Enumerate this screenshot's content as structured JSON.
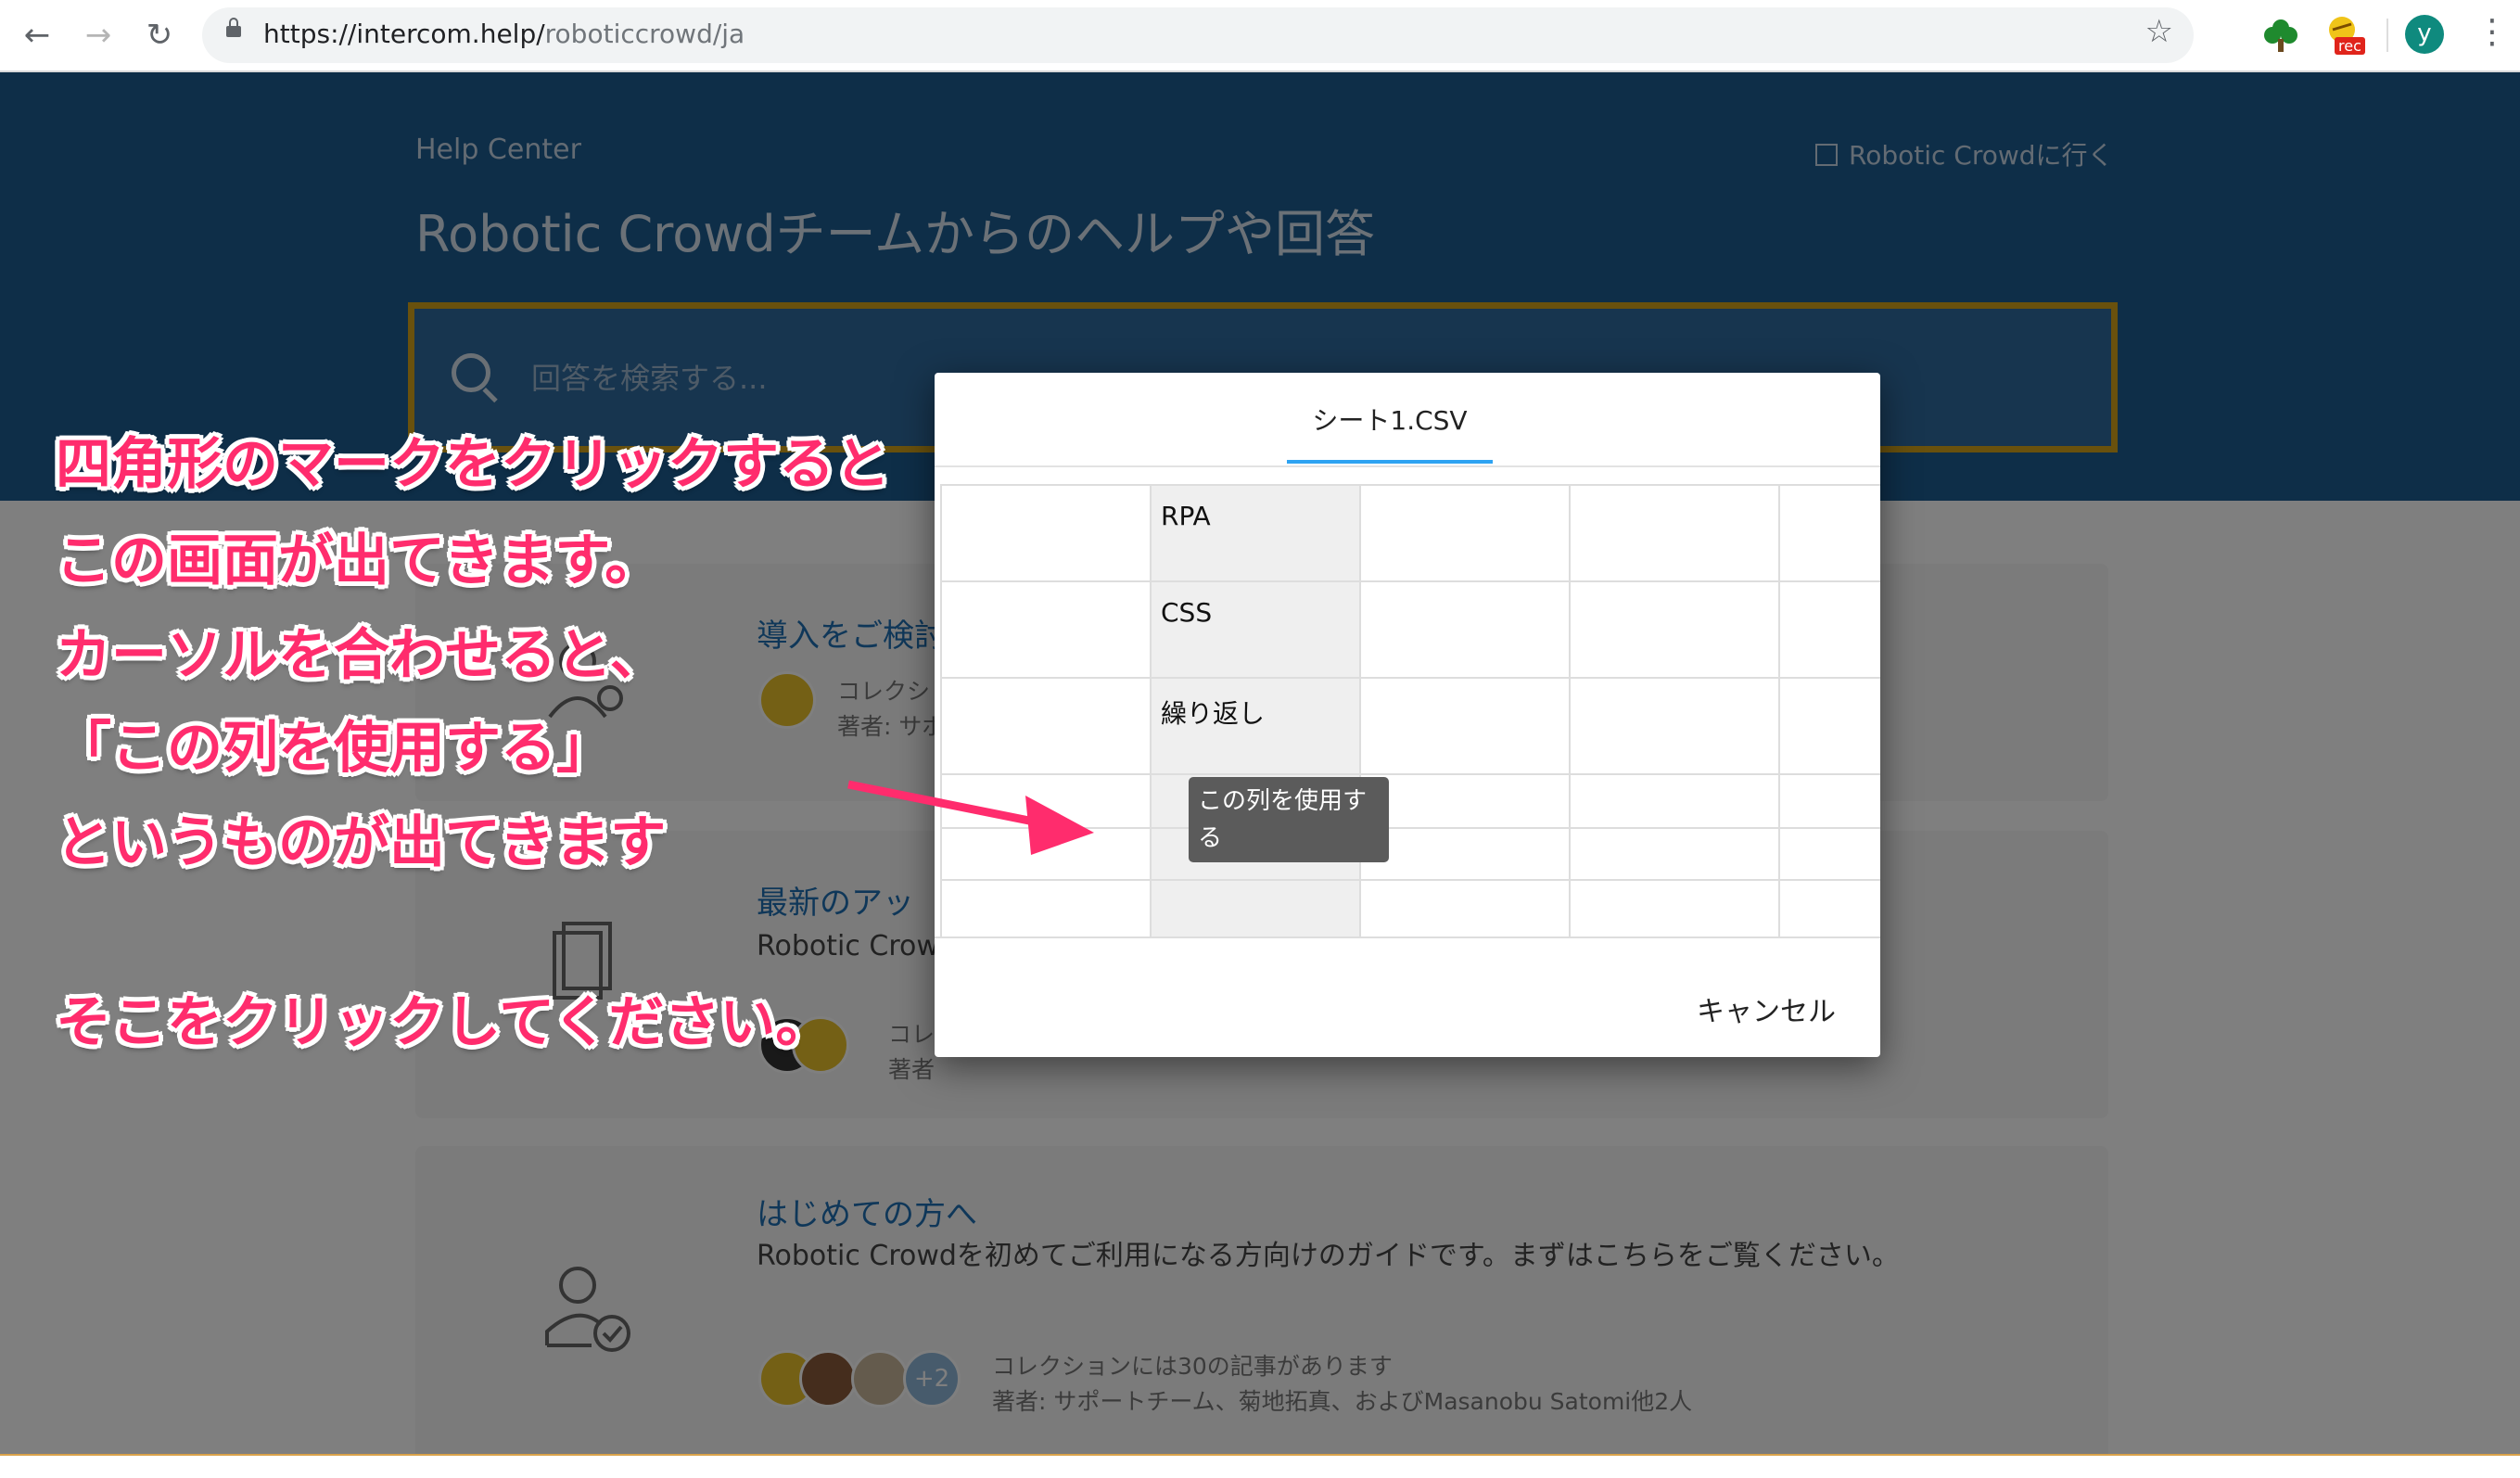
{
  "browser": {
    "url_host": "https://intercom.help/",
    "url_path": "roboticcrowd/ja",
    "profile_initial": "y",
    "rec_badge": "rec"
  },
  "help": {
    "help_center_label": "Help Center",
    "goto_link": "Robotic Crowdに行く",
    "title": "Robotic Crowdチームからのヘルプや回答",
    "search_placeholder": "回答を検索する..."
  },
  "cards": [
    {
      "title": "導入をご検討",
      "meta1": "コレクシ",
      "meta2": "著者: サポ"
    },
    {
      "title": "最新のアッ",
      "desc": "Robotic Crow",
      "meta1": "コレ",
      "meta2": "著者"
    },
    {
      "title": "はじめての方へ",
      "desc": "Robotic Crowdを初めてご利用になる方向けのガイドです。まずはこちらをご覧ください。",
      "meta1": "コレクションには30の記事があります",
      "meta2": "著者: サポートチーム、菊地拓真、およびMasanobu Satomi他2人",
      "extra_badge": "+2"
    }
  ],
  "modal": {
    "tab_label": "シート1.CSV",
    "rows": [
      "RPA",
      "CSS",
      "繰り返し"
    ],
    "tooltip": "この列を使用する",
    "cancel_label": "キャンセル"
  },
  "annotation": {
    "lines": [
      "四角形のマークをクリックすると",
      "この画面が出てきます。",
      "カーソルを合わせると、",
      "「この列を使用する」",
      "というものが出てきます",
      "そこをクリックしてください。"
    ]
  },
  "colors": {
    "hero_bg": "#1c5c91",
    "search_border": "#d3a21b",
    "link": "#1f6fb2",
    "annotation_text": "#ff2c6d",
    "tab_underline": "#2ea3f2"
  }
}
